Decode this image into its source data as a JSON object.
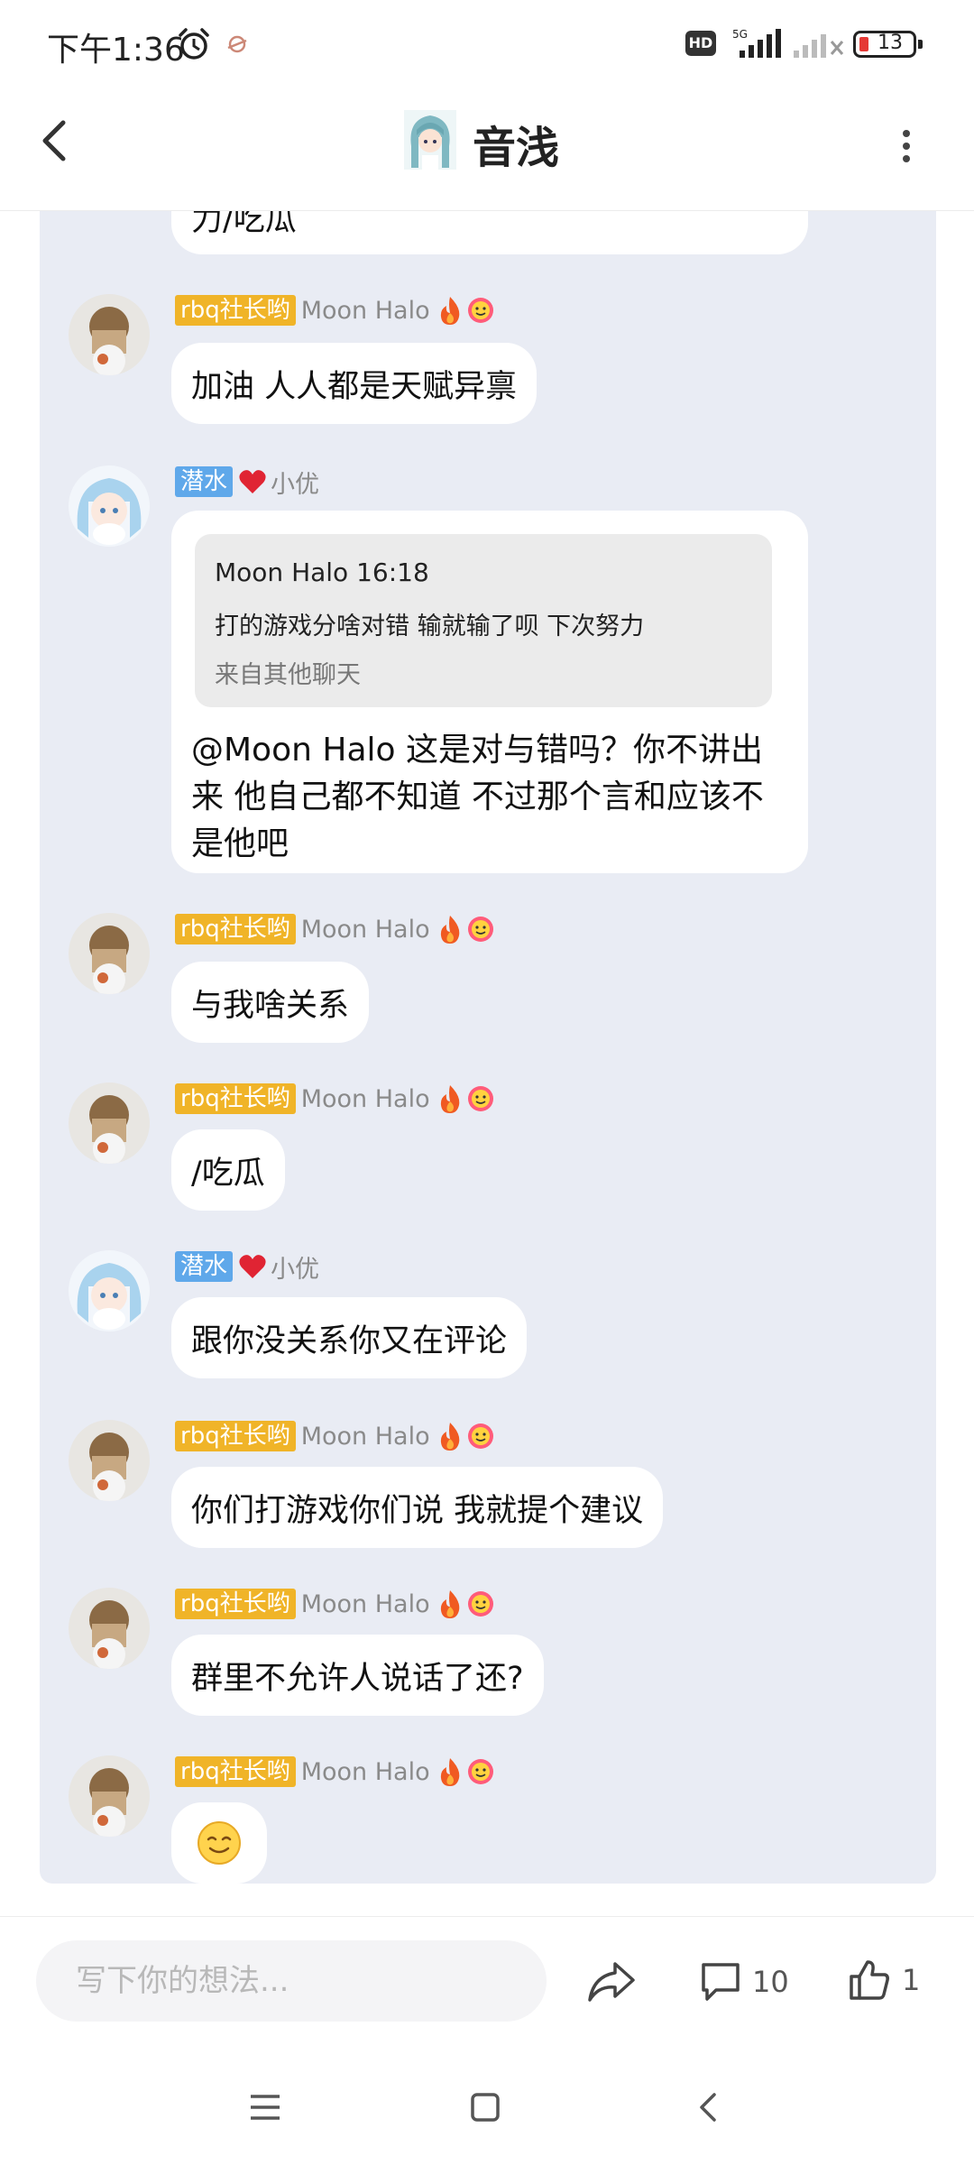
{
  "status_bar": {
    "time": "下午1:36",
    "hd": "HD",
    "network": "5G",
    "battery": "13"
  },
  "header": {
    "title": "音浅"
  },
  "messages": [
    {
      "text": "力/吃瓜"
    },
    {
      "badge": "rbq社长哟",
      "nick": "Moon Halo",
      "text": "加油 人人都是天赋异禀"
    },
    {
      "badge": "潜水",
      "nick": "小优",
      "quote": {
        "head": "Moon Halo 16:18",
        "text": "打的游戏分啥对错 输就输了呗 下次努力",
        "source": "来自其他聊天"
      },
      "text": "@Moon Halo 这是对与错吗？你不讲出来 他自己都不知道 不过那个言和应该不是他吧"
    },
    {
      "badge": "rbq社长哟",
      "nick": "Moon Halo",
      "text": "与我啥关系"
    },
    {
      "badge": "rbq社长哟",
      "nick": "Moon Halo",
      "text": "/吃瓜"
    },
    {
      "badge": "潜水",
      "nick": "小优",
      "text": "跟你没关系你又在评论"
    },
    {
      "badge": "rbq社长哟",
      "nick": "Moon Halo",
      "text": "你们打游戏你们说 我就提个建议"
    },
    {
      "badge": "rbq社长哟",
      "nick": "Moon Halo",
      "text": "群里不允许人说话了还?"
    },
    {
      "badge": "rbq社长哟",
      "nick": "Moon Halo",
      "emoji": "smile"
    }
  ],
  "bottom_bar": {
    "input_placeholder": "写下你的想法...",
    "comment_count": "10",
    "like_count": "1"
  },
  "colors": {
    "chat_background": "#e9ecf4",
    "badge_gold": "#f0b428",
    "badge_blue": "#5fa8ea"
  },
  "icons": [
    "alarm-icon",
    "back-arrow-icon",
    "more-vertical-icon",
    "fire-icon",
    "smile-badge-icon",
    "heart-icon",
    "share-icon",
    "comment-icon",
    "like-icon",
    "menu-icon",
    "home-icon",
    "back-icon"
  ]
}
